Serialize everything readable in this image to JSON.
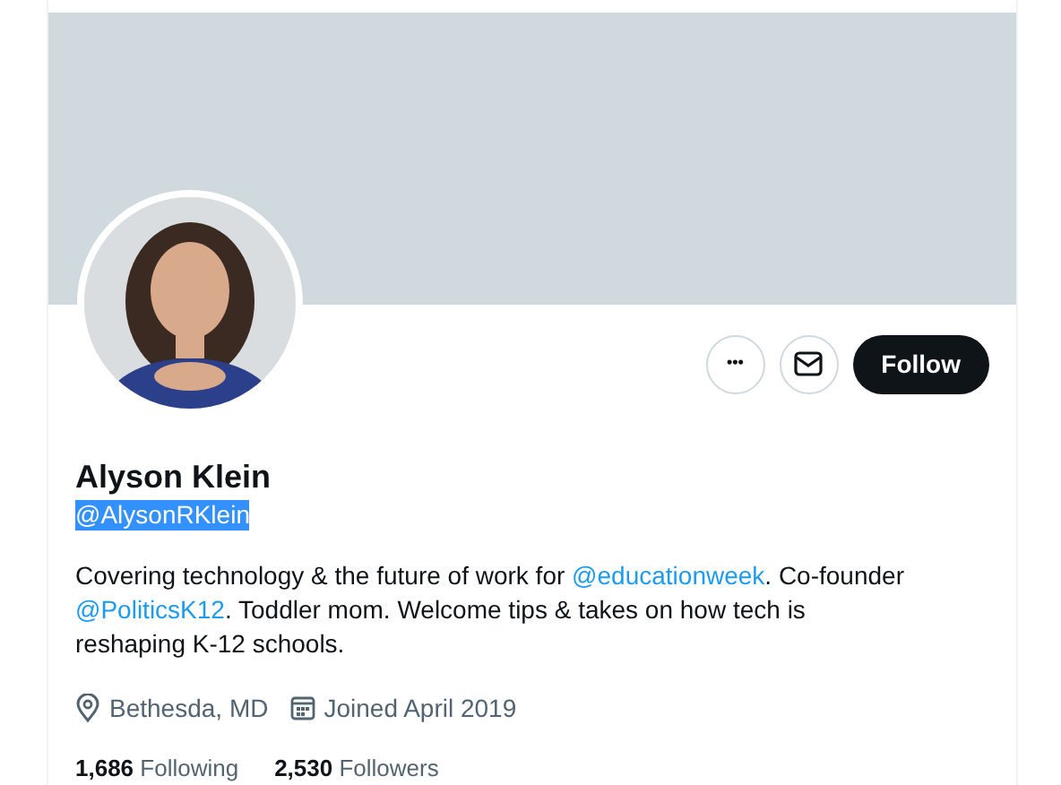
{
  "profile": {
    "name": "Alyson Klein",
    "handle": {
      "text": "@AlysonRKlein",
      "selected": true
    },
    "actions": [
      {
        "kind": "more",
        "label": "•••"
      },
      {
        "kind": "message"
      },
      {
        "kind": "follow",
        "label": "Follow"
      }
    ],
    "bio": [
      {
        "kind": "text",
        "text": "Covering technology & the future of work for "
      },
      {
        "kind": "mention",
        "text": "@educationweek"
      },
      {
        "kind": "text",
        "text": ". Co-founder "
      },
      {
        "kind": "mention",
        "text": "@PoliticsK12"
      },
      {
        "kind": "text",
        "text": ". Toddler mom. Welcome tips & takes on how tech is reshaping K-12 schools."
      }
    ],
    "meta": [
      {
        "kind": "location",
        "text": "Bethesda, MD"
      },
      {
        "kind": "joined",
        "text": "Joined April 2019"
      }
    ],
    "stats": [
      {
        "count": "1,686",
        "label": "Following"
      },
      {
        "count": "2,530",
        "label": "Followers"
      }
    ]
  }
}
